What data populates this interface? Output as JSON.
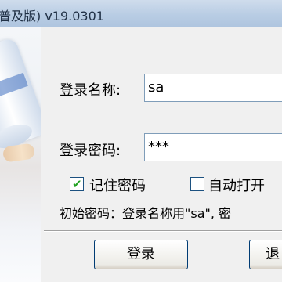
{
  "window": {
    "title": "普及版) v19.0301"
  },
  "form": {
    "username_label": "登录名称:",
    "username_value": "sa",
    "password_label": "登录密码:",
    "password_value": "***",
    "remember_password_label": "记住密码",
    "remember_password_checked": true,
    "auto_open_label": "自动打开",
    "auto_open_checked": false,
    "hint_text": "初始密码：登录名称用\"sa\",  密"
  },
  "buttons": {
    "login_label": "登录",
    "second_label": "退"
  },
  "colors": {
    "titlebar": "#b9cde4",
    "checkmark": "#21a121",
    "input_border": "#7f9db9"
  }
}
